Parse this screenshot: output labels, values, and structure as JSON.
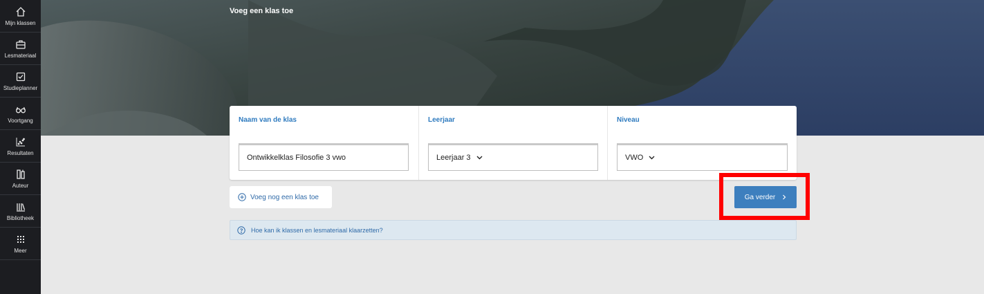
{
  "sidebar": {
    "items": [
      {
        "label": "Mijn klassen",
        "icon": "home-icon"
      },
      {
        "label": "Lesmateriaal",
        "icon": "briefcase-icon"
      },
      {
        "label": "Studieplanner",
        "icon": "checkbox-icon"
      },
      {
        "label": "Voortgang",
        "icon": "glasses-icon"
      },
      {
        "label": "Resultaten",
        "icon": "scatter-chart-icon"
      },
      {
        "label": "Auteur",
        "icon": "author-icon"
      },
      {
        "label": "Bibliotheek",
        "icon": "library-icon"
      },
      {
        "label": "Meer",
        "icon": "grid-dots-icon"
      }
    ]
  },
  "hero": {
    "title": "Voeg een klas toe"
  },
  "form": {
    "class_name": {
      "label": "Naam van de klas",
      "value": "Ontwikkelklas Filosofie 3 vwo"
    },
    "year": {
      "label": "Leerjaar",
      "value": "Leerjaar 3"
    },
    "level": {
      "label": "Niveau",
      "value": "VWO"
    }
  },
  "actions": {
    "add_class": "Voeg nog een klas toe",
    "continue": "Ga verder"
  },
  "info": {
    "text": "Hoe kan ik klassen en lesmateriaal klaarzetten?"
  },
  "colors": {
    "accent": "#3d7fbe",
    "sidebar": "#1c1d21",
    "highlight": "#ff0000",
    "info_bg": "#dde8f0"
  }
}
